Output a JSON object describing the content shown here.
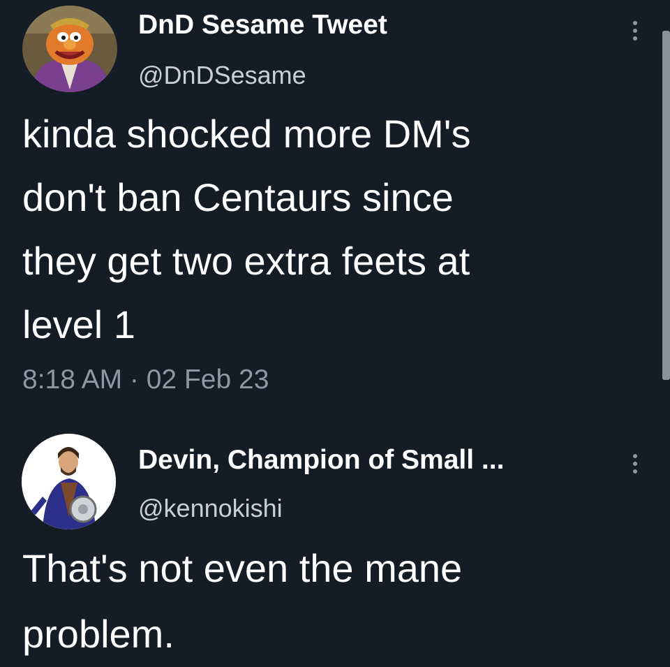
{
  "tweets": [
    {
      "display_name": "DnD Sesame Tweet",
      "handle": "@DnDSesame",
      "text": "kinda shocked more DM's\ndon't ban Centaurs since\nthey get two extra feets  at\nlevel 1",
      "timestamp": "8:18 AM · 02 Feb 23"
    },
    {
      "display_name": "Devin, Champion of Small ...",
      "handle": "@kennokishi",
      "text": "That's not even the mane\nproblem."
    }
  ],
  "colors": {
    "background": "#141d26",
    "primary_text": "#ffffff",
    "secondary_text": "#8b98a5"
  },
  "icons": {
    "more_menu": "more-vertical-icon"
  }
}
